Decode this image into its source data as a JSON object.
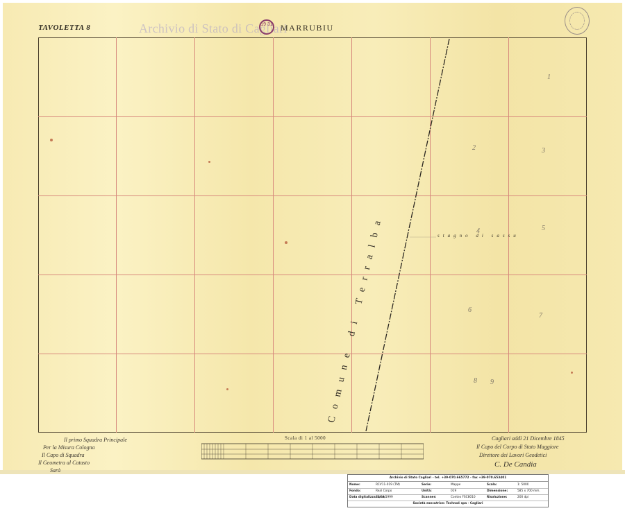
{
  "header": {
    "tavoletta": "TAVOLETTA 8",
    "watermark": "Archivio di Stato di Cagliari",
    "map_title": "MARRUBIU",
    "stamp_text": "19 31"
  },
  "map": {
    "comune_label": "Comune di Terralba",
    "stagno_label": "stagno di sassu",
    "parcels": [
      "1",
      "2",
      "3",
      "4",
      "5",
      "6",
      "7",
      "8",
      "9"
    ],
    "scale_label": "Scala di 1 al 5000"
  },
  "signatures": {
    "left_lines": [
      "Il primo Squadra Principale",
      "Per la Misura Cologna",
      "Il Capo di Squadra",
      "Il Geometra al Catasto",
      "Sarà"
    ],
    "right_lines": [
      "Cagliari addì 21 Dicembre 1845",
      "Il Capo del Corpo di Stato Maggiore",
      "Direttore dei Lavori Geodetici",
      "C. De Candia"
    ]
  },
  "infobox": {
    "header": "Archivio di Stato Cagliari - tel. +39-070.665772 - fax +39-070.653401",
    "rows": [
      [
        {
          "label": "Nome:",
          "value": "RCV11-019 (TM)"
        },
        {
          "label": "Serie:",
          "value": "Mappe"
        },
        {
          "label": "Scala:",
          "value": "1: 5000"
        }
      ],
      [
        {
          "label": "Fondo:",
          "value": "Real Corpo"
        },
        {
          "label": "Unità:",
          "value": "019"
        },
        {
          "label": "Dimensione:",
          "value": "585 x 700 mm."
        }
      ],
      [
        {
          "label": "Data digitalizzazione:",
          "value": "21/03/1999"
        },
        {
          "label": "Scanner:",
          "value": "Contex FSC8010"
        },
        {
          "label": "Risoluzione:",
          "value": "200 dpi"
        }
      ]
    ],
    "footer": "Società esecutrice: Technoé spa - Cagliari"
  }
}
